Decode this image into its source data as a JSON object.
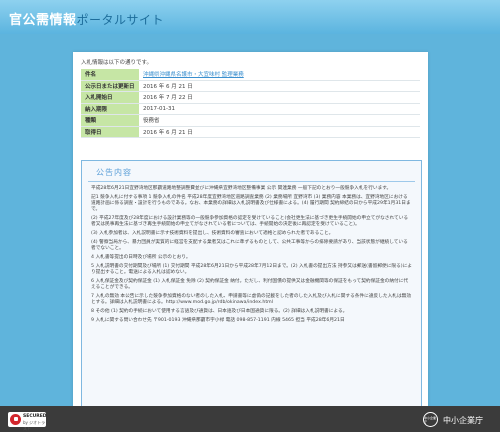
{
  "header": {
    "title_main": "官公需情報",
    "title_sub": "ポータルサイト"
  },
  "intro": "入札情報は以下の通りです。",
  "info_rows": [
    {
      "label": "件名",
      "value": "沖縄県沖縄県名護市・大宜味村 監理業務",
      "is_link": true
    },
    {
      "label": "公示日または更新日",
      "value": "2016 年 6 月 21 日"
    },
    {
      "label": "入札開始日",
      "value": "2016 年 7 月 22 日"
    },
    {
      "label": "納入期限",
      "value": "2017-01-31"
    },
    {
      "label": "種類",
      "value": "役務省"
    },
    {
      "label": "取得日",
      "value": "2016 年 6 月 21 日"
    }
  ],
  "notice": {
    "title": "公告内容",
    "paragraphs": [
      "平成28年6月21日宜野湾地区那覇道路地整調整費並びに沖縄県宜野湾地区整備事業 公示 関連業務 一般下記のとおり一般競争入札を行います。",
      "記1 競争入札に付する事項 1 競争入札の件名 平成28年度宜野湾地区道路調査業務 (2) 業務場所 宜野湾市 (3) 業務内容 本業務は、宜野湾地区における道路計画に係る調査・設計を行うものである。なお、本業務の詳細は入札説明書及び仕様書による。(4) 履行期間 契約締結の日から平成29年1月31日まで。",
      "(2) 平成27年度及び28年度における設計業務等の一般競争参加資格の認定を受けていること(会社更生法に基づき更生手続開始の申立てがなされている者又は民事再生法に基づき再生手続開始の申立てがなされている者については、手続開始の決定後に再認定を受けていること)。",
      "(3) 入札参加者は、入札説明書に示す技術資料を提出し、技術資料の審査において適格と認められた者であること。",
      "(4) 警察当局から、暴力団員が実質的に経営を支配する業者又はこれに準ずるものとして、公共工事等からの排除要請があり、当該状態が継続している者でないこと。",
      "4 入札書等提出の日時及び場所 公示のとおり。",
      "5 入札説明書の交付期間及び場所 (1) 交付期間 平成28年6月21日から平成28年7月12日まで。(2) 入札書の提出方法 持参又は郵送(書留郵便に限る)により提出すること。電送による入札は認めない。",
      "6 入札保証金及び契約保証金 (1) 入札保証金 免除 (2) 契約保証金 納付。ただし、利付国債の提供又は金融機関等の保証をもって契約保証金の納付に代えることができる。",
      "7 入札の無効 本公告に示した競争参加資格のない者のした入札、申請書等に虚偽の記載をした者のした入札及び入札に関する条件に違反した入札は無効とする。詳細は入札説明書による。http://www.mod.go.jp/rdb/okinawa/index.html",
      "8 その他 (1) 契約の手続において使用する言語及び通貨は、日本語及び日本国通貨に限る。(2) 詳細は入札説明書による。",
      "9 入札に関する問い合わせ先 〒901-0193 沖縄県那覇市字小禄 電話 098-857-1191 内線 5465 担当 平成28年6月21日"
    ]
  },
  "footer": {
    "secured_line1": "SECURED",
    "secured_line2": "by ジオトラスト",
    "logo_circle_text": "中小企業庁",
    "logo_text": "中小企業庁"
  }
}
